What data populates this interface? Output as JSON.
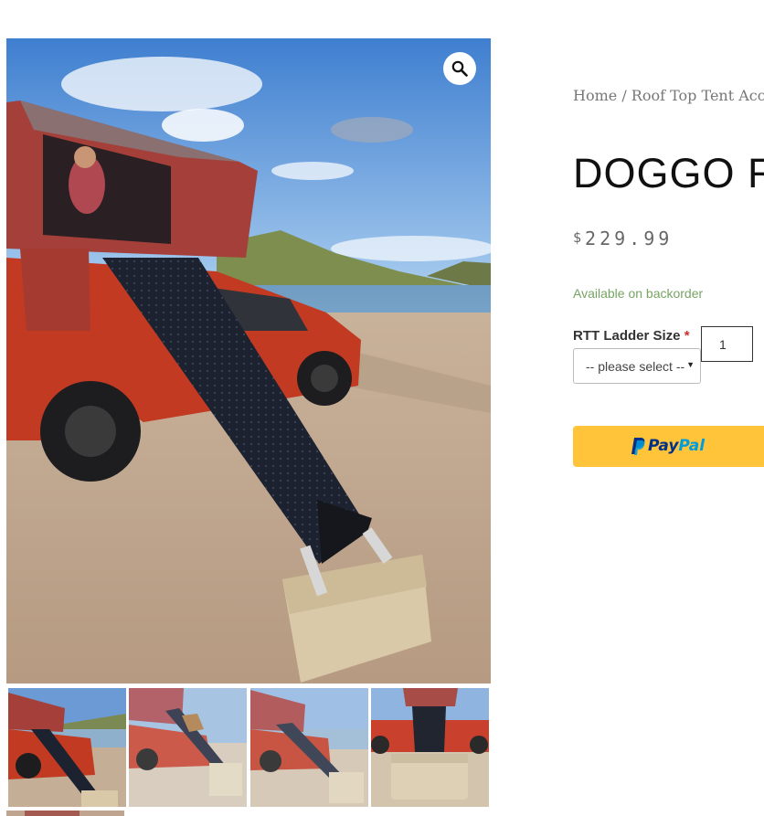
{
  "breadcrumb": {
    "home": "Home",
    "separator": " / ",
    "category": "Roof Top Tent Accessories"
  },
  "product": {
    "title": "DOGGO RTT LADDER COVER",
    "currency": "$",
    "price": "229.99",
    "stock_status": "Available on backorder"
  },
  "variation": {
    "label": "RTT Ladder Size",
    "required_mark": "*",
    "selected": "-- please select --"
  },
  "quantity": {
    "value": "1"
  },
  "paypal": {
    "pay": "Pay",
    "pal": "Pal"
  },
  "gallery": {
    "main_image": "Red pickup truck with open rooftop tent and black ladder cover resting on a tan cooler on a lakeshore beach",
    "thumbnails": [
      "thumbnail-1",
      "thumbnail-2",
      "thumbnail-3",
      "thumbnail-4"
    ]
  },
  "colors": {
    "paypal_yellow": "#ffc439",
    "stock_green": "#77a464",
    "required_red": "#d32f2f"
  }
}
